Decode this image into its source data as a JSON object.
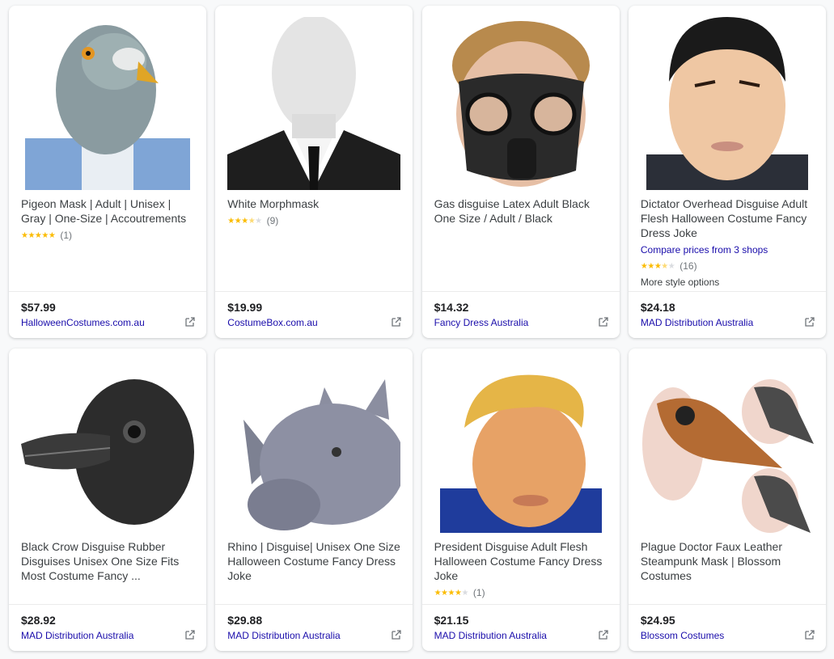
{
  "products": [
    {
      "title": "Pigeon Mask | Adult | Unisex | Gray | One-Size | Accoutrements",
      "rating": 5,
      "reviews": "(1)",
      "price": "$57.99",
      "seller": "HalloweenCostumes.com.au",
      "image": "pigeon-mask"
    },
    {
      "title": "White Morphmask",
      "rating": 3.5,
      "reviews": "(9)",
      "price": "$19.99",
      "seller": "CostumeBox.com.au",
      "image": "morphmask"
    },
    {
      "title": "Gas disguise Latex Adult Black One Size / Adult / Black",
      "price": "$14.32",
      "seller": "Fancy Dress Australia",
      "image": "gas-mask"
    },
    {
      "title": "Dictator Overhead Disguise Adult Flesh Halloween Costume Fancy Dress Joke",
      "compare": "Compare prices from 3 shops",
      "rating": 3.5,
      "reviews": "(16)",
      "more": "More style options",
      "price": "$24.18",
      "seller": "MAD Distribution Australia",
      "image": "dictator-mask"
    },
    {
      "title": "Black Crow Disguise Rubber Disguises Unisex One Size Fits Most Costume Fancy ...",
      "price": "$28.92",
      "seller": "MAD Distribution Australia",
      "image": "crow-mask"
    },
    {
      "title": "Rhino | Disguise| Unisex One Size Halloween Costume Fancy Dress Joke",
      "price": "$29.88",
      "seller": "MAD Distribution Australia",
      "image": "rhino-mask"
    },
    {
      "title": "President Disguise Adult Flesh Halloween Costume Fancy Dress Joke",
      "rating": 4,
      "reviews": "(1)",
      "price": "$21.15",
      "seller": "MAD Distribution Australia",
      "image": "president-mask"
    },
    {
      "title": "Plague Doctor Faux Leather Steampunk Mask | Blossom Costumes",
      "price": "$24.95",
      "seller": "Blossom Costumes",
      "image": "plague-doctor-mask"
    }
  ],
  "icons": {
    "external": "external-link-icon",
    "star": "star-icon"
  },
  "colors": {
    "link": "#1a0dab",
    "star": "#fbbc04",
    "price": "#202124"
  }
}
